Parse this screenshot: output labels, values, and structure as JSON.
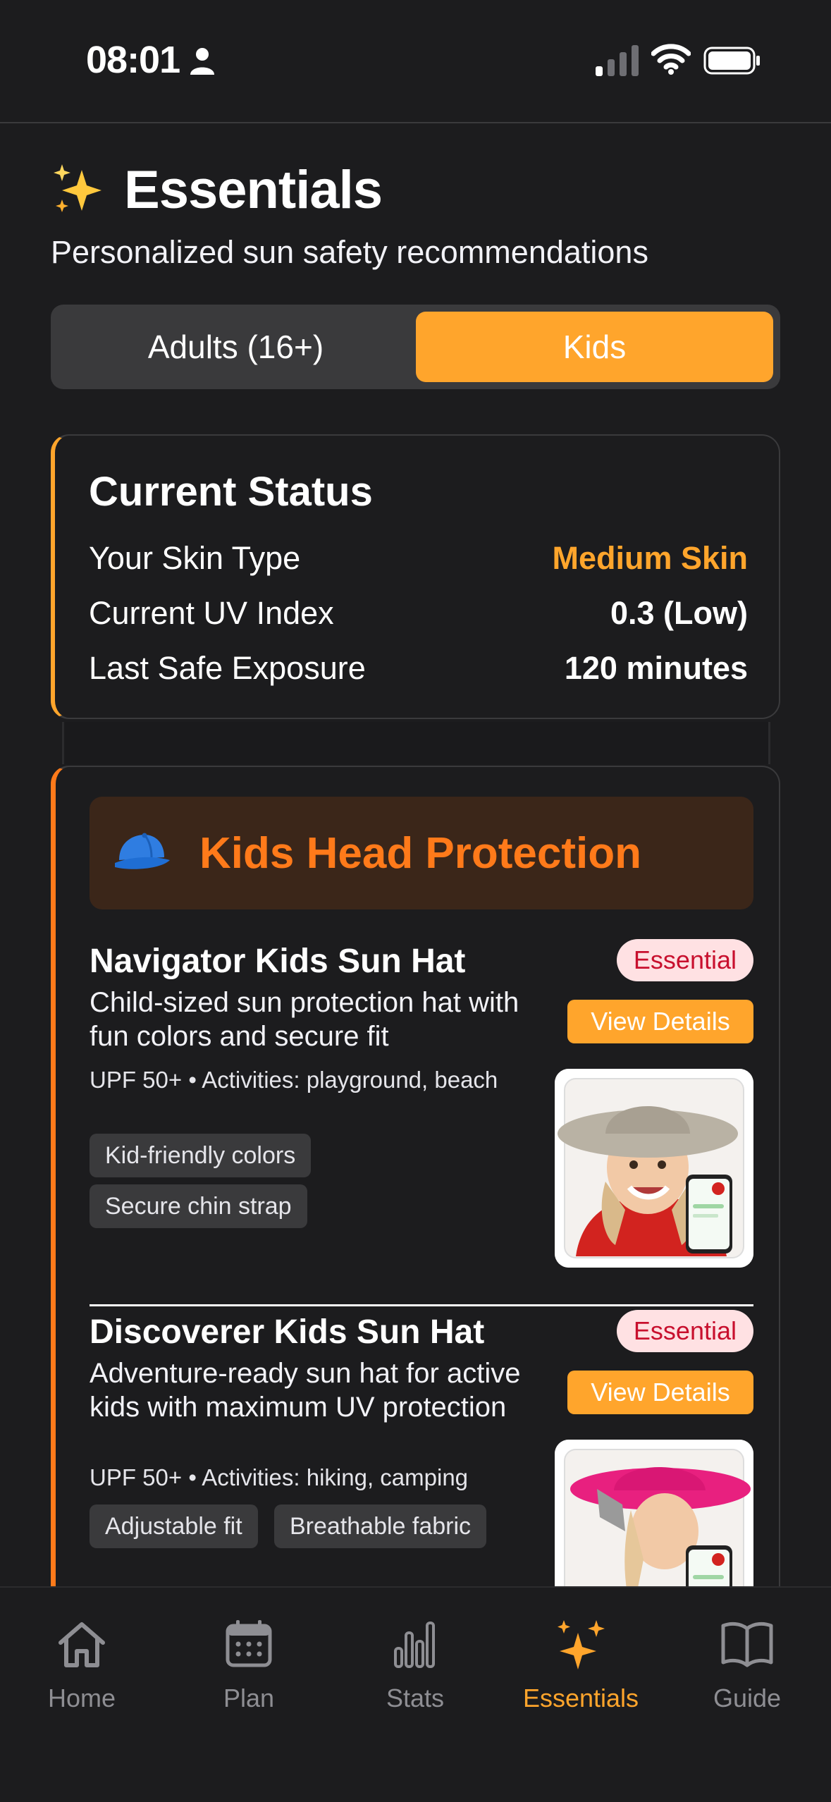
{
  "status_bar": {
    "time": "08:01"
  },
  "header": {
    "title": "Essentials",
    "subtitle": "Personalized sun safety recommendations"
  },
  "segment": {
    "adults_label": "Adults (16+)",
    "kids_label": "Kids",
    "selected": "Kids"
  },
  "current_status": {
    "title": "Current Status",
    "rows": [
      {
        "label": "Your Skin Type",
        "value": "Medium Skin"
      },
      {
        "label": "Current UV Index",
        "value": "0.3 (Low)"
      },
      {
        "label": "Last Safe Exposure",
        "value": "120 minutes"
      }
    ]
  },
  "category": {
    "title": "Kids Head Protection",
    "products": [
      {
        "name": "Navigator Kids Sun Hat",
        "badge": "Essential",
        "button": "View Details",
        "description": "Child-sized sun protection hat with fun colors and secure fit",
        "meta": "UPF 50+ • Activities: playground, beach",
        "tags": [
          "Kid-friendly colors",
          "Secure chin strap"
        ]
      },
      {
        "name": "Discoverer Kids Sun Hat",
        "badge": "Essential",
        "button": "View Details",
        "description": "Adventure-ready sun hat for active kids with maximum UV protection",
        "meta": "UPF 50+ • Activities: hiking, camping",
        "tags": [
          "Adjustable fit",
          "Breathable fabric"
        ]
      }
    ]
  },
  "tabbar": {
    "items": [
      {
        "label": "Home",
        "icon": "house-icon"
      },
      {
        "label": "Plan",
        "icon": "calendar-icon"
      },
      {
        "label": "Stats",
        "icon": "bar-chart-icon"
      },
      {
        "label": "Essentials",
        "icon": "sparkles-icon"
      },
      {
        "label": "Guide",
        "icon": "book-icon"
      }
    ],
    "active": "Essentials"
  },
  "colors": {
    "accent": "#ffa52c",
    "category_accent": "#ff7a1a",
    "essential_badge_bg": "#ffe1e3",
    "essential_badge_text": "#c8102e"
  }
}
